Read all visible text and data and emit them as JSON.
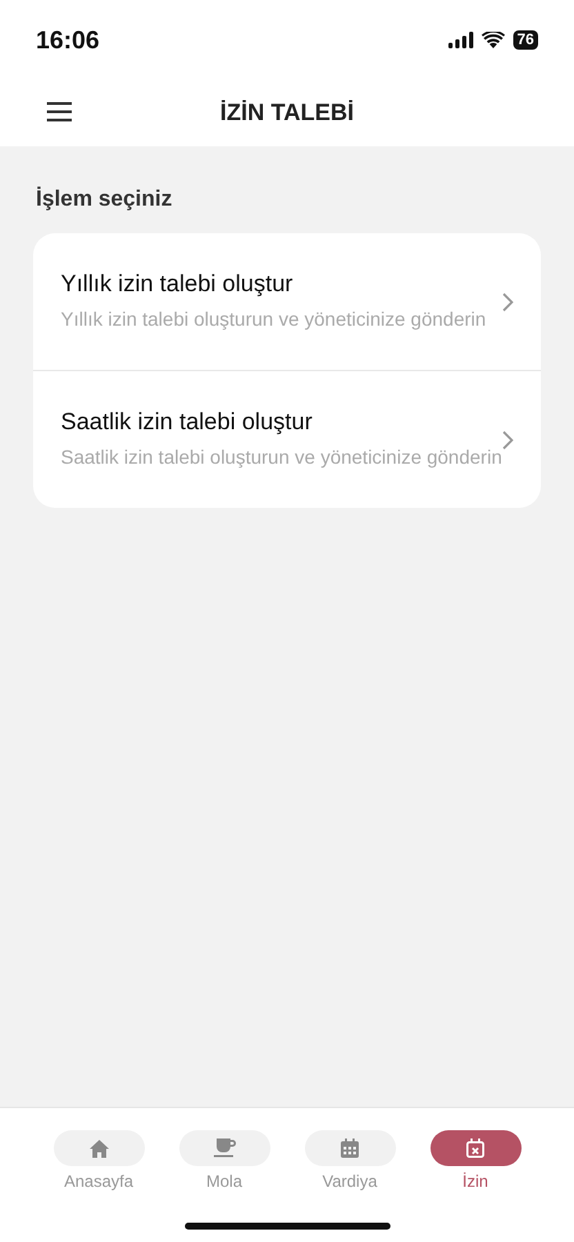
{
  "status_bar": {
    "time": "16:06",
    "battery": "76"
  },
  "header": {
    "title": "İZİN TALEBİ"
  },
  "section": {
    "title": "İşlem seçiniz"
  },
  "options": [
    {
      "title": "Yıllık izin talebi oluştur",
      "subtitle": "Yıllık izin talebi oluşturun ve yöneticinize gönderin"
    },
    {
      "title": "Saatlik izin talebi oluştur",
      "subtitle": "Saatlik izin talebi oluşturun ve yöneticinize gönderin"
    }
  ],
  "tabs": [
    {
      "label": "Anasayfa",
      "kind": "home",
      "selected": false
    },
    {
      "label": "Mola",
      "kind": "break",
      "selected": false
    },
    {
      "label": "Vardiya",
      "kind": "shift",
      "selected": false
    },
    {
      "label": "İzin",
      "kind": "leave",
      "selected": true
    }
  ]
}
